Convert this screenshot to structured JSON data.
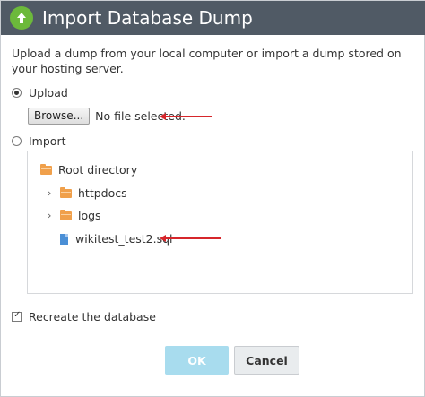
{
  "dialog": {
    "title": "Import Database Dump",
    "title_icon": "upload-icon",
    "intro": "Upload a dump from your local computer or import a dump stored on your hosting server."
  },
  "upload": {
    "label": "Upload",
    "selected": true,
    "browse_label": "Browse...",
    "file_status": "No file selected."
  },
  "import": {
    "label": "Import",
    "selected": false,
    "tree": {
      "root": "Root directory",
      "folders": [
        "httpdocs",
        "logs"
      ],
      "file": "wikitest_test2.sql"
    }
  },
  "recreate": {
    "label": "Recreate the database",
    "checked": true
  },
  "buttons": {
    "ok": "OK",
    "cancel": "Cancel"
  },
  "colors": {
    "titlebar": "#505a65",
    "accent_green": "#6cb93b",
    "folder": "#f0a04b",
    "annotation_arrow": "#d6262b",
    "ok_disabled": "#a8dcee"
  }
}
